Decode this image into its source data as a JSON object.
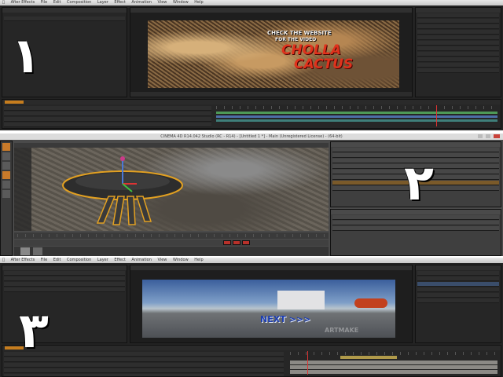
{
  "panel1": {
    "menu": [
      "After Effects",
      "File",
      "Edit",
      "Composition",
      "Layer",
      "Effect",
      "Animation",
      "View",
      "Window",
      "Help"
    ],
    "step_number": "١",
    "preview_text": {
      "top_line_1": "CHECK THE WEBSITE",
      "top_line_2": "FOR THE VIDEO",
      "title_1": "CHOLLA",
      "title_2": "CACTUS"
    },
    "colors": {
      "title": "#e0321c",
      "subtitle": "#f4f4f4"
    }
  },
  "panel2": {
    "window_title": "CINEMA 4D R14.042 Studio (RC - R14) - [Untitled 1 *] - Main (Unregistered License) - (64-bit)",
    "step_number": "٢"
  },
  "panel3": {
    "menu": [
      "After Effects",
      "File",
      "Edit",
      "Composition",
      "Layer",
      "Effect",
      "Animation",
      "View",
      "Window",
      "Help"
    ],
    "step_number": "٣",
    "preview_text": {
      "next": "NEXT >>>",
      "watermark": "ARTMAKE"
    },
    "colors": {
      "next": "#1e3fb0",
      "helicopter": "#c2411e"
    }
  }
}
